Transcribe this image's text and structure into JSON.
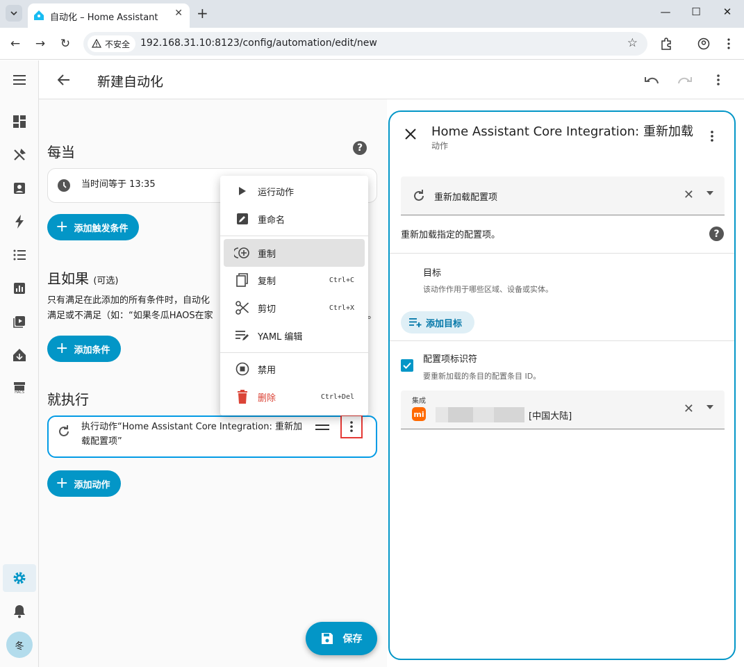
{
  "browser": {
    "tab_title": "自动化 – Home Assistant",
    "insecure_label": "不安全",
    "url": "192.168.31.10:8123/config/automation/edit/new"
  },
  "header": {
    "title": "新建自动化"
  },
  "editor": {
    "triggers": {
      "title": "每当",
      "items": [
        {
          "text": "当时间等于 13:35"
        }
      ],
      "add_label": "添加触发条件"
    },
    "conditions": {
      "title": "且如果",
      "optional": "(可选)",
      "description_line1": "只有满足在此添加的所有条件时，自动化",
      "description_line2": "满足或不满足（如：“如果冬瓜HAOS在家",
      "description_tail": "。",
      "add_label": "添加条件"
    },
    "actions": {
      "title": "就执行",
      "items": [
        {
          "text_line1": "执行动作“Home Assistant Core Integration: 重新加",
          "text_line2": "载配置项”"
        }
      ],
      "add_label": "添加动作"
    },
    "save_label": "保存"
  },
  "context_menu": {
    "items": [
      {
        "label": "运行动作",
        "icon": "play-icon",
        "shortcut": ""
      },
      {
        "label": "重命名",
        "icon": "rename-icon",
        "shortcut": ""
      },
      {
        "label": "重制",
        "icon": "duplicate-icon",
        "shortcut": ""
      },
      {
        "label": "复制",
        "icon": "copy-icon",
        "shortcut": "Ctrl+C"
      },
      {
        "label": "剪切",
        "icon": "cut-icon",
        "shortcut": "Ctrl+X"
      },
      {
        "label": "YAML 编辑",
        "icon": "yaml-edit-icon",
        "shortcut": ""
      },
      {
        "label": "禁用",
        "icon": "disable-icon",
        "shortcut": ""
      },
      {
        "label": "删除",
        "icon": "delete-icon",
        "shortcut": "Ctrl+Del"
      }
    ],
    "highlighted": "重制"
  },
  "panel": {
    "title": "Home Assistant Core Integration: 重新加载",
    "subtitle": "动作",
    "action_select": "重新加载配置项",
    "description": "重新加载指定的配置项。",
    "target": {
      "title": "目标",
      "help": "该动作作用于哪些区域、设备或实体。",
      "add_label": "添加目标"
    },
    "entry": {
      "title": "配置项标识符",
      "help": "要重新加载的条目的配置条目 ID。",
      "checked": true,
      "field_label": "集成",
      "value_suffix": "[中国大陆]"
    }
  },
  "sidebar": {
    "avatar_initial": "冬",
    "hacs_label": "HACS"
  },
  "colors": {
    "accent": "#0396c7",
    "danger": "#db4437",
    "highlight_border": "#e53935",
    "xiaomi": "#ff6900"
  }
}
